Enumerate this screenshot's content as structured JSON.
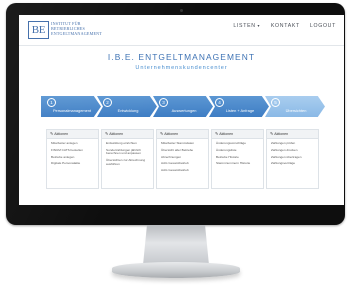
{
  "logo": {
    "mark": "BE",
    "lines": [
      "INSTITUT FÜR",
      "BETRIEBLICHES",
      "ENTGELTMANAGEMENT"
    ]
  },
  "nav": {
    "items": [
      {
        "label": "LISTEN",
        "has_dropdown": true
      },
      {
        "label": "KONTAKT",
        "has_dropdown": false
      },
      {
        "label": "LOGOUT",
        "has_dropdown": false
      }
    ]
  },
  "hero": {
    "title": "I.B.E. ENTGELTMANAGEMENT",
    "subtitle": "Unternehmenskundencenter"
  },
  "steps": [
    {
      "number": "1",
      "label": "Personalmanagement"
    },
    {
      "number": "2",
      "label": "Entwicklung"
    },
    {
      "number": "3",
      "label": "Auswertungen"
    },
    {
      "number": "4",
      "label": "Listen + Anfrage"
    },
    {
      "number": "5",
      "label": "Übersichten"
    }
  ],
  "cards": [
    {
      "header": "Aktionen",
      "items": [
        "Mitarbeiter anlegen",
        "FINUM CATS bestellen",
        "Betriebe anlegen",
        "Digitale Personalakte"
      ]
    },
    {
      "header": "Aktionen",
      "items": [
        "Entwicklung einrichten",
        "Sonderzahlungen jährlich berechnen und anpassen",
        "Übersichten zur Abrechnung ausführen"
      ]
    },
    {
      "header": "Aktionen",
      "items": [
        "Mitarbeiter Stammdaten",
        "Übersicht aller Betriebe",
        "Abrechnungen",
        "AAG Gesamtbetrieb",
        "AAG Gesamtbetrieb"
      ]
    },
    {
      "header": "Aktionen",
      "items": [
        "Änderungsvorschläge",
        "Änderungsliste",
        "Betriebe Historie",
        "Stammnummern Historie"
      ]
    },
    {
      "header": "Aktionen",
      "items": [
        "Zahlungen prüfen",
        "Zahlungen drucken",
        "Zahlungen übertragen",
        "Zahlungsverträge"
      ]
    }
  ],
  "colors": {
    "brand": "#3d6aa8",
    "step_active": "#3e7dc4",
    "step_last": "#8ab9e6",
    "title": "#3d72b4",
    "subtitle": "#4a8fd0",
    "monitor_bezel": "#0e0e0e"
  },
  "icons": {
    "card_header_icon": "pencil-icon",
    "nav_dropdown_icon": "caret-down-icon"
  }
}
